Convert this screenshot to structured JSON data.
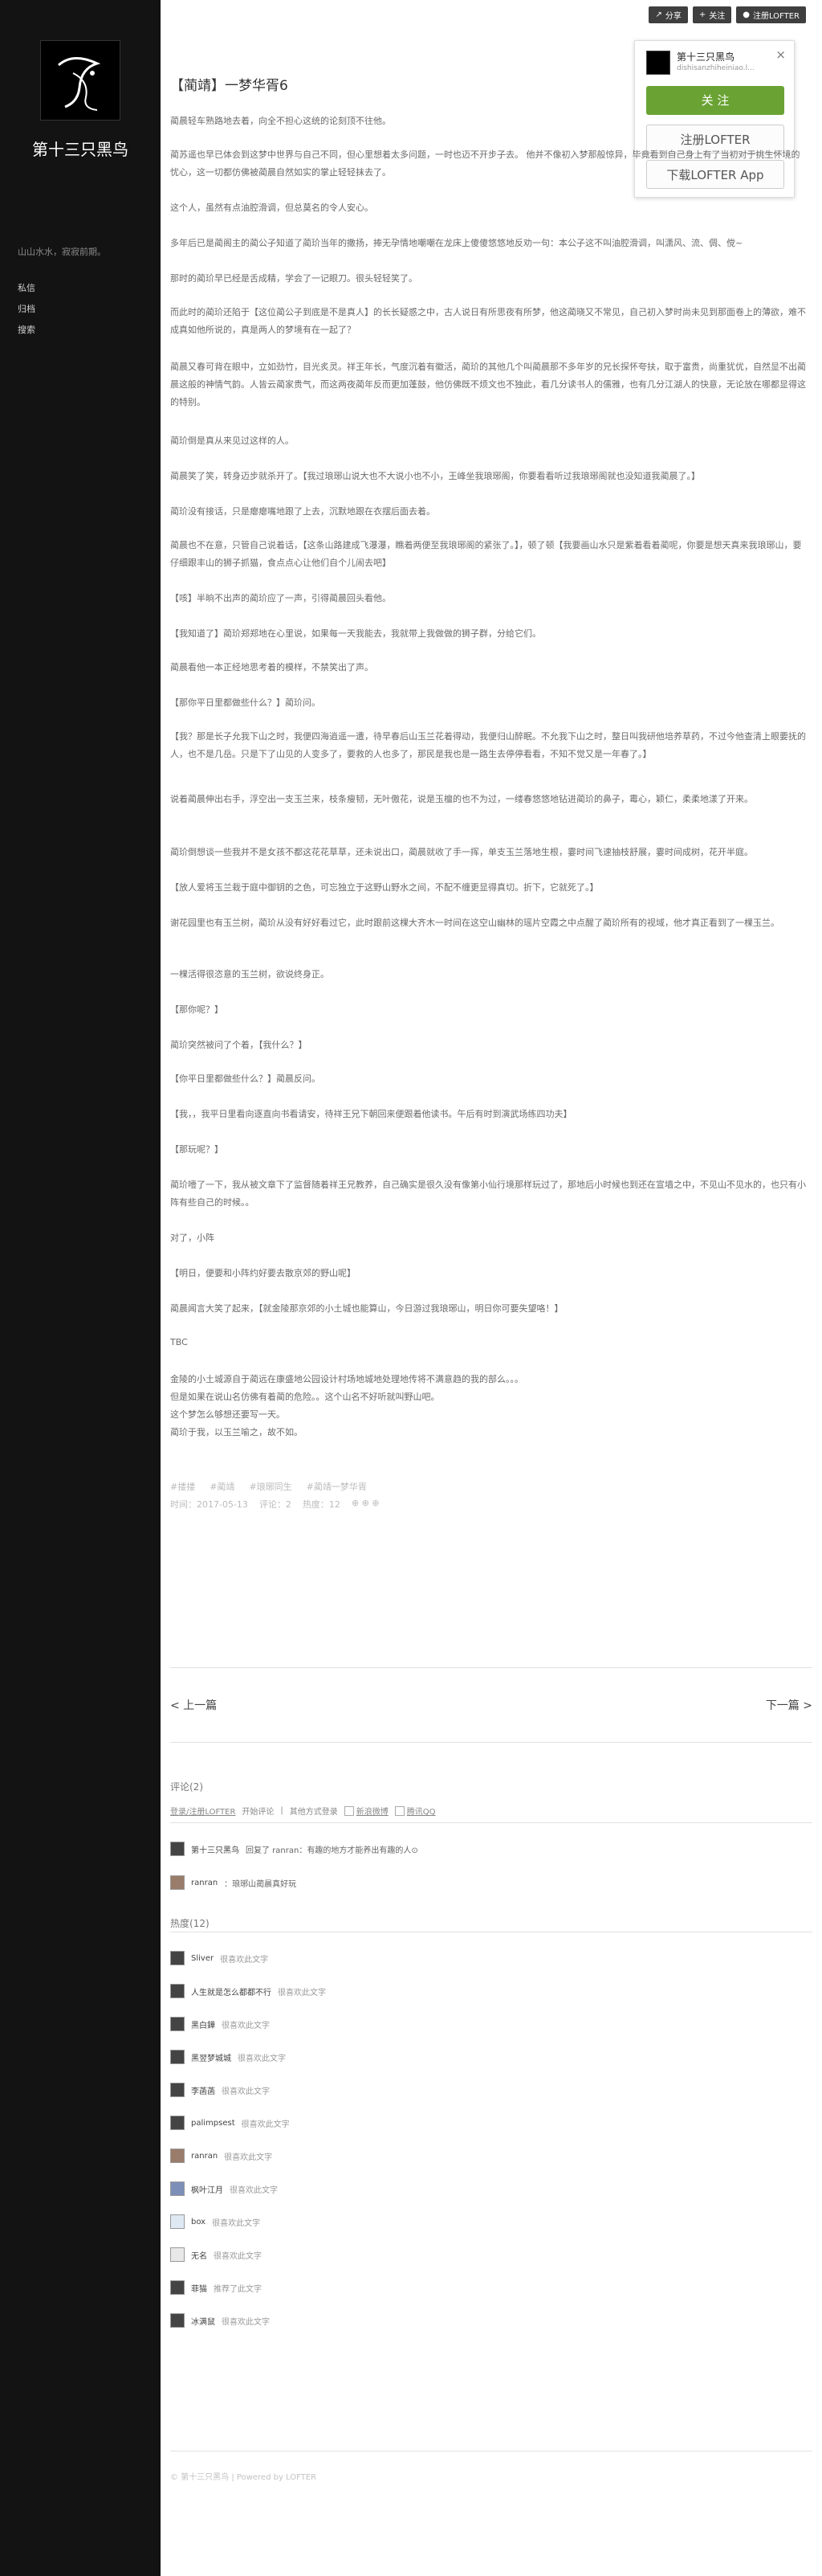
{
  "sidebar": {
    "blog_name": "第十三只黑鸟",
    "tagline": "山山水水，寂寂前期。",
    "nav": [
      "私信",
      "归档",
      "搜索"
    ]
  },
  "topbar": {
    "share": "分享",
    "follow": "关注",
    "register": "注册LOFTER"
  },
  "popup": {
    "name": "第十三只黑鸟",
    "sub": "dishisanzhiheiniao.l...",
    "follow": "关 注",
    "register": "注册LOFTER",
    "download": "下载LOFTER App"
  },
  "post": {
    "title": "【蔺靖】一梦华胥6",
    "paragraphs": [
      "蔺晨轻车熟路地去着，向全不担心这统的论刻顶不往他。",
      "蔺苏遥也早已体会到这梦中世界与自己不同，但心里想着太多问题，一时也迈不开步子去。 他并不像初入梦那般惊异，毕竟看到自己身上有了当初对于挑生怀境的忧心，这一切都仿佛被蔺晨自然如实的掌止轻轻抹去了。",
      "这个人，虽然有点油腔滑调，但总莫名的令人安心。",
      "多年后已是蔺阁主的蔺公子知道了蔺玠当年的撒扬，捧无孕情地嘲嘲在龙床上傻傻悠悠地反劝一句：本公子这不叫油腔滑调，叫潇风、流、倜、傥~",
      "那时的蔺玠早已经是舌成精，学会了一记眼刀。很头轻轻笑了。",
      "而此时的蔺玠还陷于【这位蔺公子到底是不是真人】的长长疑惑之中，古人说日有所思夜有所梦，他这蔺晓又不常见，自己初入梦时尚未见到那面卷上的薄欲，难不成真如他所说的，真是两人的梦境有在一起了？",
      "蔺晨又春可背在眼中，立如劲竹，目光炙灵。祥王年长，气度沉着有徽活，蔺玠的其他几个叫蔺晨那不多年岁的兄长探怀夸扶，取于富贵，尚重犹优，自然显不出蔺晨这般的神情气韵。人皆云蔺家贵气，而这两夜蔺年反而更加蓬鼓，他仿佛既不烦文也不独此，看几分读书人的儒雅，也有几分江湖人的快意，无论放在哪都显得这的特别。",
      "蔺玠倒是真从来见过这样的人。",
      "蔺晨笑了笑，转身迈步就杀开了。【我过琅琊山说大也不大说小也不小，王峰坐我琅琊阁，你要看看听过我琅琊阁就也没知道我蔺晨了。】",
      "蔺玠没有接话，只是瘪瘪嘴地跟了上去，沉默地跟在衣摆后面去着。",
      "蔺晨也不在意，只管自己说着话，【这条山路建成飞瀑瀑，瞧着两便至我琅琊阁的紧张了。】，顿了顿【我要画山水只是紫着看着蔺呢，你要是想天真来我琅琊山，要仔细跟丰山的狮子抓猫，食点点心让他们自个儿闹去吧】",
      "【咳】半晌不出声的蔺玠应了一声，引得蔺晨回头看他。",
      "【我知道了】蔺玠郑郑地在心里说，如果每一天我能去，我就带上我做做的狮子群，分给它们。",
      "蔺晨看他一本正经地思考着的模样，不禁笑出了声。",
      "【那你平日里都做些什么？】蔺玠问。",
      "【我？那是长子允我下山之时，我便四海逍遥一遭，待早春后山玉兰花着得动，我便归山醉眠。不允我下山之时，整日叫我研他培养草药，不过今他查清上眼要抚的人，也不是几岳。只是下了山见的人变多了，要救的人也多了，那民是我也是一路生去停停看看，不知不觉又是一年春了。】",
      "说着蔺晨伸出右手，浮空出一支玉兰来，枝条瘦韧，无叶傲花，说是玉檀的也不为过，一缕春悠悠地钻进蔺玠的鼻子，霉心，颖仁，柔柔地漾了开来。",
      "蔺玠倒想谈一些我并不是女孩不都这花花草草，还未说出口，蔺晨就收了手一挥，单支玉兰落地生根，霎时间飞速抽枝舒展，霎时间成树，花开半庭。",
      "【放人爱将玉兰栽于庭中御钥的之色，可忘独立于这野山野水之间，不配不缠更显得真切。折下，它就死了。】",
      "谢花园里也有玉兰树，蔺玠从没有好好看过它，此时跟前这棵大齐木一时间在这空山幽林的瑶片空霞之中点醒了蔺玠所有的视域，他才真正看到了一棵玉兰。",
      "一棵活得很恣意的玉兰树，欲说终身正。",
      "【那你呢？】",
      "蔺玠突然被问了个着，【我什么？】",
      "【你平日里都做些什么？】蔺晨反问。",
      "【我，，我平日里看向逐直向书看请安，待祥王兄下朝回来便跟着他读书。午后有时到演武场练四功夫】",
      "【那玩呢？】",
      "蔺玠噎了一下，我从被文章下了监督随着祥王兄教养，自己确实是很久没有像第小仙行境那样玩过了，那地后小时候也到还在宣墙之中，不见山不见水的，也只有小阵有些自己的时候。。",
      "对了，小阵",
      "【明日，便要和小阵约好要去散京郊的野山呢】",
      "蔺晨闻言大笑了起来，【就金陵那京郊的小土城也能算山，今日游过我琅琊山，明日你可要失望咯！】",
      "TBC",
      "金陵的小土城源自于蔺远在康盛地公园设计村场地城地处理地传将不满意趋的我的部么。。。\n但是如果在说山名仿佛有着蔺的危险。。这个山名不好听就叫野山吧。\n这个梦怎么够想还要写一天。\n蔺玠于我，以玉兰喻之，故不如。"
    ],
    "tags": [
      "#搂搂",
      "#蔺靖",
      "#琅琊同生",
      "#蔺靖一梦华胥"
    ],
    "meta": [
      "时间：2017-05-13",
      "评论：2",
      "热度：12"
    ]
  },
  "nav": {
    "prev": "< 上一篇",
    "next": "下一篇 >"
  },
  "comments": {
    "heading": "评论(2)",
    "login_link": "登录/注册LOFTER",
    "login_tail": "开始评论",
    "other": "其他方式登录",
    "weibo": "新浪微博",
    "qq": "腾讯QQ",
    "items": [
      {
        "user": "第十三只黑鸟",
        "text": "回复了 ranran：有趣的地方才能养出有趣的人⊙"
      },
      {
        "user": "ranran",
        "text": "：琅琊山蔺晨真好玩"
      }
    ]
  },
  "hot": {
    "heading": "热度(12)",
    "items": [
      {
        "name": "Sliver",
        "action": "很喜欢此文字"
      },
      {
        "name": "人生就是怎么都都不行",
        "action": "很喜欢此文字"
      },
      {
        "name": "黑白鏵",
        "action": "很喜欢此文字"
      },
      {
        "name": "黑翌梦城城",
        "action": "很喜欢此文字"
      },
      {
        "name": "李菡菡",
        "action": "很喜欢此文字"
      },
      {
        "name": "palimpsest",
        "action": "很喜欢此文字"
      },
      {
        "name": "ranran",
        "action": "很喜欢此文字"
      },
      {
        "name": "枫叶江月",
        "action": "很喜欢此文字"
      },
      {
        "name": "box",
        "action": "很喜欢此文字"
      },
      {
        "name": "无名",
        "action": "很喜欢此文字"
      },
      {
        "name": "菲猫",
        "action": "推荐了此文字"
      },
      {
        "name": "冰满鼠",
        "action": "很喜欢此文字"
      }
    ]
  },
  "footer": "© 第十三只黑鸟 | Powered by LOFTER"
}
